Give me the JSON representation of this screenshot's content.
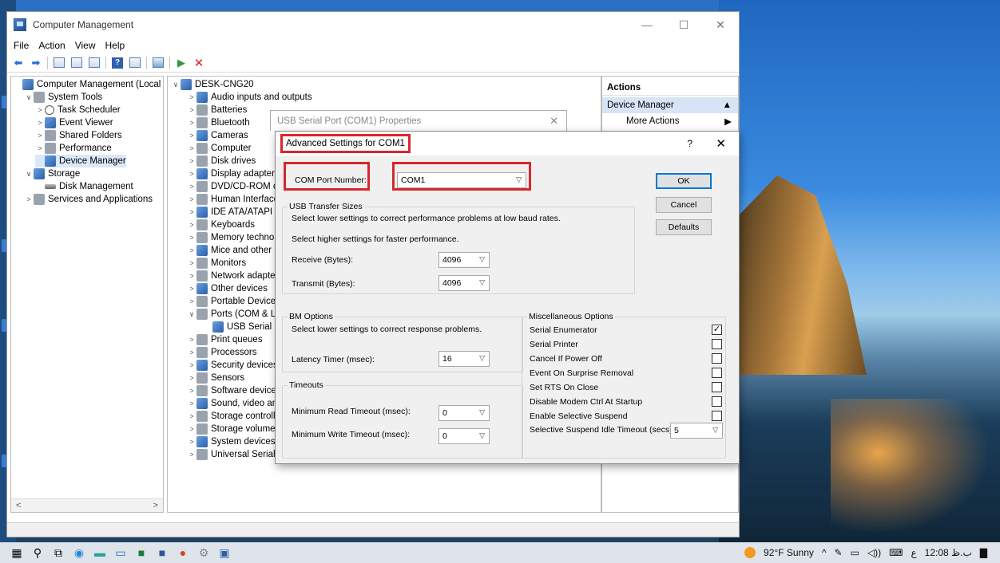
{
  "window": {
    "title": "Computer Management"
  },
  "menu": [
    "File",
    "Action",
    "View",
    "Help"
  ],
  "left_tree": [
    {
      "label": "Computer Management (Local",
      "indent": 0,
      "exp": ""
    },
    {
      "label": "System Tools",
      "indent": 1,
      "exp": "v"
    },
    {
      "label": "Task Scheduler",
      "indent": 2,
      "exp": ">"
    },
    {
      "label": "Event Viewer",
      "indent": 2,
      "exp": ">"
    },
    {
      "label": "Shared Folders",
      "indent": 2,
      "exp": ">"
    },
    {
      "label": "Performance",
      "indent": 2,
      "exp": ">"
    },
    {
      "label": "Device Manager",
      "indent": 2,
      "exp": "",
      "selected": true
    },
    {
      "label": "Storage",
      "indent": 1,
      "exp": "v"
    },
    {
      "label": "Disk Management",
      "indent": 2,
      "exp": ""
    },
    {
      "label": "Services and Applications",
      "indent": 1,
      "exp": ">"
    }
  ],
  "device_tree": {
    "root": "DESK-CNG20",
    "items": [
      "Audio inputs and outputs",
      "Batteries",
      "Bluetooth",
      "Cameras",
      "Computer",
      "Disk drives",
      "Display adapters",
      "DVD/CD-ROM d",
      "Human Interface",
      "IDE ATA/ATAPI c",
      "Keyboards",
      "Memory technol",
      "Mice and other p",
      "Monitors",
      "Network adapter",
      "Other devices",
      "Portable Devices",
      "Ports (COM & LI",
      "USB Serial Po",
      "Print queues",
      "Processors",
      "Security devices",
      "Sensors",
      "Software devices",
      "Sound, video an",
      "Storage controlle",
      "Storage volumes",
      "System devices",
      "Universal Serial Bus controllers"
    ]
  },
  "actions": {
    "header": "Actions",
    "section": "Device Manager",
    "more": "More Actions"
  },
  "props_dialog": {
    "title": "USB Serial Port (COM1) Properties"
  },
  "adv": {
    "title": "Advanced Settings for COM1",
    "com_port_label": "COM Port Number:",
    "com_port_value": "COM1",
    "ok": "OK",
    "cancel": "Cancel",
    "defaults": "Defaults",
    "usb_group": "USB Transfer Sizes",
    "usb_line1": "Select lower settings to correct performance problems at low baud rates.",
    "usb_line2": "Select higher settings for faster performance.",
    "receive_label": "Receive (Bytes):",
    "receive_value": "4096",
    "transmit_label": "Transmit (Bytes):",
    "transmit_value": "4096",
    "bm_group": "BM Options",
    "bm_line": "Select lower settings to correct response problems.",
    "latency_label": "Latency Timer (msec):",
    "latency_value": "16",
    "timeouts_group": "Timeouts",
    "min_read_label": "Minimum Read Timeout (msec):",
    "min_read_value": "0",
    "min_write_label": "Minimum Write Timeout (msec):",
    "min_write_value": "0",
    "misc_group": "Miscellaneous Options",
    "misc": [
      {
        "label": "Serial Enumerator",
        "checked": true
      },
      {
        "label": "Serial Printer",
        "checked": false
      },
      {
        "label": "Cancel If Power Off",
        "checked": false
      },
      {
        "label": "Event On Surprise Removal",
        "checked": false
      },
      {
        "label": "Set RTS On Close",
        "checked": false
      },
      {
        "label": "Disable Modem Ctrl At Startup",
        "checked": false
      },
      {
        "label": "Enable Selective Suspend",
        "checked": false
      }
    ],
    "suspend_label": "Selective Suspend Idle Timeout (secs):",
    "suspend_value": "5"
  },
  "taskbar": {
    "weather": "92°F Sunny",
    "lang": "ﻉ",
    "time": "12:08 ب.ظ"
  }
}
